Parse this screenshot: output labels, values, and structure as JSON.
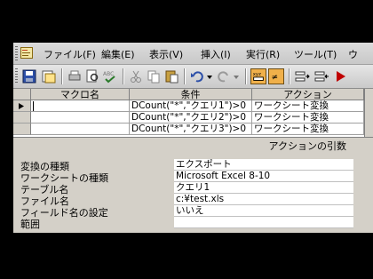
{
  "menubar": {
    "items": [
      "ファイル(F)",
      "編集(E)",
      "表示(V)",
      "挿入(I)",
      "実行(R)",
      "ツール(T)",
      "ウ"
    ]
  },
  "grid": {
    "headers": {
      "macro_name": "マクロ名",
      "condition": "条件",
      "action": "アクション"
    },
    "rows": [
      {
        "condition": "DCount(\"*\",\"クエリ1\")>0",
        "action": "ワークシート変換"
      },
      {
        "condition": "DCount(\"*\",\"クエリ2\")>0",
        "action": "ワークシート変換"
      },
      {
        "condition": "DCount(\"*\",\"クエリ3\")>0",
        "action": "ワークシート変換"
      }
    ]
  },
  "args_panel": {
    "title": "アクションの引数",
    "args": [
      {
        "label": "変換の種類",
        "value": "エクスポート"
      },
      {
        "label": "ワークシートの種類",
        "value": "Microsoft Excel 8-10"
      },
      {
        "label": "テーブル名",
        "value": "クエリ1"
      },
      {
        "label": "ファイル名",
        "value": "c:¥test.xls"
      },
      {
        "label": "フィールド名の設定",
        "value": "いいえ"
      },
      {
        "label": "範囲",
        "value": ""
      }
    ]
  },
  "colors": {
    "window_bg": "#d4d0c8",
    "highlight_button": "#f0b04a"
  }
}
